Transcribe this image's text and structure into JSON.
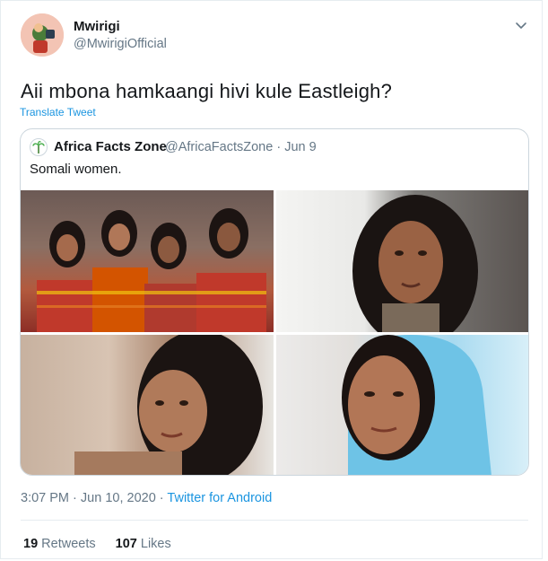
{
  "tweet": {
    "author": {
      "name": "Mwirigi",
      "handle": "@MwirigiOfficial"
    },
    "text": "Aii mbona hamkaangi hivi kule Eastleigh?",
    "translate_label": "Translate Tweet",
    "quoted": {
      "name": "Africa Facts Zone",
      "handle": "@AfricaFactsZone",
      "separator": "·",
      "date": "Jun 9",
      "text": "Somali women."
    },
    "footer": {
      "time": "3:07 PM",
      "separator": "·",
      "date": "Jun 10, 2020",
      "source": "Twitter for Android"
    },
    "stats": {
      "retweets_count": "19",
      "retweets_label": "Retweets",
      "likes_count": "107",
      "likes_label": "Likes"
    }
  },
  "colors": {
    "link": "#1b95e0",
    "secondary_text": "#657786",
    "border": "#e6ecf0"
  },
  "icons": {
    "more": "chevron-down-icon",
    "quoted_avatar": "palm-tree-icon"
  }
}
